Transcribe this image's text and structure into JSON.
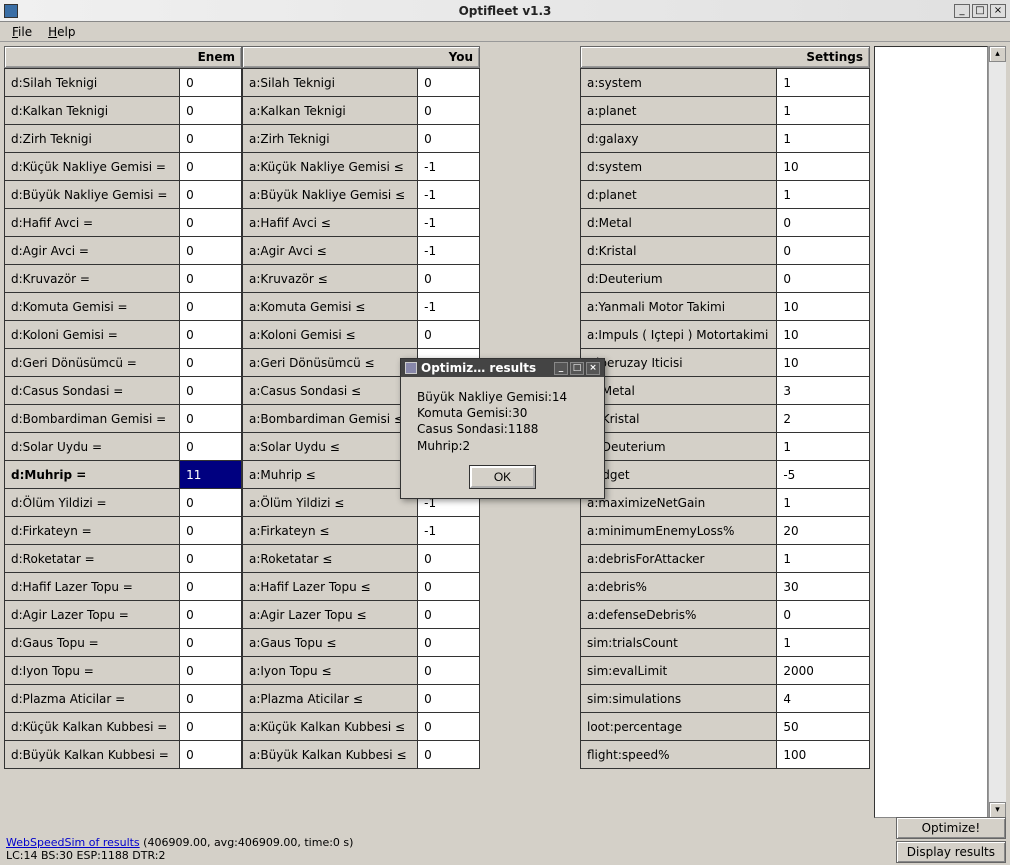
{
  "window": {
    "title": "Optifleet v1.3",
    "min": "_",
    "max": "□",
    "close": "×"
  },
  "menu": {
    "file": "File",
    "help": "Help"
  },
  "headers": {
    "enemy": "Enem",
    "you": "You",
    "settings": "Settings"
  },
  "enemy_rows": [
    {
      "label": "d:Silah Teknigi",
      "val": "0"
    },
    {
      "label": "d:Kalkan Teknigi",
      "val": "0"
    },
    {
      "label": "d:Zirh Teknigi",
      "val": "0"
    },
    {
      "label": "d:Küçük Nakliye Gemisi =",
      "val": "0"
    },
    {
      "label": "d:Büyük Nakliye Gemisi =",
      "val": "0"
    },
    {
      "label": "d:Hafif Avci =",
      "val": "0"
    },
    {
      "label": "d:Agir Avci =",
      "val": "0"
    },
    {
      "label": "d:Kruvazör =",
      "val": "0"
    },
    {
      "label": "d:Komuta Gemisi =",
      "val": "0"
    },
    {
      "label": "d:Koloni Gemisi =",
      "val": "0"
    },
    {
      "label": "d:Geri Dönüsümcü =",
      "val": "0"
    },
    {
      "label": "d:Casus Sondasi =",
      "val": "0"
    },
    {
      "label": "d:Bombardiman Gemisi =",
      "val": "0"
    },
    {
      "label": "d:Solar Uydu =",
      "val": "0"
    },
    {
      "label": "d:Muhrip =",
      "val": "11",
      "bold": true,
      "sel": true
    },
    {
      "label": "d:Ölüm Yildizi =",
      "val": "0"
    },
    {
      "label": "d:Firkateyn =",
      "val": "0"
    },
    {
      "label": "d:Roketatar =",
      "val": "0"
    },
    {
      "label": "d:Hafif Lazer Topu =",
      "val": "0"
    },
    {
      "label": "d:Agir Lazer Topu =",
      "val": "0"
    },
    {
      "label": "d:Gaus Topu =",
      "val": "0"
    },
    {
      "label": "d:Iyon Topu =",
      "val": "0"
    },
    {
      "label": "d:Plazma Aticilar =",
      "val": "0"
    },
    {
      "label": "d:Küçük Kalkan Kubbesi =",
      "val": "0"
    },
    {
      "label": "d:Büyük Kalkan Kubbesi =",
      "val": "0"
    }
  ],
  "you_rows": [
    {
      "label": "a:Silah Teknigi",
      "val": "0"
    },
    {
      "label": "a:Kalkan Teknigi",
      "val": "0"
    },
    {
      "label": "a:Zirh Teknigi",
      "val": "0"
    },
    {
      "label": "a:Küçük Nakliye Gemisi ≤",
      "val": "-1"
    },
    {
      "label": "a:Büyük Nakliye Gemisi ≤",
      "val": "-1"
    },
    {
      "label": "a:Hafif Avci ≤",
      "val": "-1"
    },
    {
      "label": "a:Agir Avci ≤",
      "val": "-1"
    },
    {
      "label": "a:Kruvazör ≤",
      "val": "0"
    },
    {
      "label": "a:Komuta Gemisi ≤",
      "val": "-1"
    },
    {
      "label": "a:Koloni Gemisi ≤",
      "val": "0"
    },
    {
      "label": "a:Geri Dönüsümcü ≤",
      "val": ""
    },
    {
      "label": "a:Casus Sondasi ≤",
      "val": ""
    },
    {
      "label": "a:Bombardiman Gemisi ≤",
      "val": ""
    },
    {
      "label": "a:Solar Uydu ≤",
      "val": ""
    },
    {
      "label": "a:Muhrip ≤",
      "val": ""
    },
    {
      "label": "a:Ölüm Yildizi ≤",
      "val": "-1"
    },
    {
      "label": "a:Firkateyn ≤",
      "val": "-1"
    },
    {
      "label": "a:Roketatar ≤",
      "val": "0"
    },
    {
      "label": "a:Hafif Lazer Topu ≤",
      "val": "0"
    },
    {
      "label": "a:Agir Lazer Topu ≤",
      "val": "0"
    },
    {
      "label": "a:Gaus Topu ≤",
      "val": "0"
    },
    {
      "label": "a:Iyon Topu ≤",
      "val": "0"
    },
    {
      "label": "a:Plazma Aticilar ≤",
      "val": "0"
    },
    {
      "label": "a:Küçük Kalkan Kubbesi ≤",
      "val": "0"
    },
    {
      "label": "a:Büyük Kalkan Kubbesi ≤",
      "val": "0"
    }
  ],
  "settings_rows": [
    {
      "label": "a:system",
      "val": "1"
    },
    {
      "label": "a:planet",
      "val": "1"
    },
    {
      "label": "d:galaxy",
      "val": "1"
    },
    {
      "label": "d:system",
      "val": "10"
    },
    {
      "label": "d:planet",
      "val": "1"
    },
    {
      "label": "d:Metal",
      "val": "0"
    },
    {
      "label": "d:Kristal",
      "val": "0"
    },
    {
      "label": "d:Deuterium",
      "val": "0"
    },
    {
      "label": "a:Yanmali Motor Takimi",
      "val": "10"
    },
    {
      "label": "a:Impuls ( Içtepi ) Motortakimi",
      "val": "10"
    },
    {
      "label": "Hiperuzay Iticisi",
      "val": "10"
    },
    {
      "label": "io:Metal",
      "val": "3"
    },
    {
      "label": "io:Kristal",
      "val": "2"
    },
    {
      "label": "io:Deuterium",
      "val": "1"
    },
    {
      "label": "budget",
      "val": "-5"
    },
    {
      "label": "a:maximizeNetGain",
      "val": "1"
    },
    {
      "label": "a:minimumEnemyLoss%",
      "val": "20"
    },
    {
      "label": "a:debrisForAttacker",
      "val": "1"
    },
    {
      "label": "a:debris%",
      "val": "30"
    },
    {
      "label": "a:defenseDebris%",
      "val": "0"
    },
    {
      "label": "sim:trialsCount",
      "val": "1"
    },
    {
      "label": "sim:evalLimit",
      "val": "2000"
    },
    {
      "label": "sim:simulations",
      "val": "4"
    },
    {
      "label": "loot:percentage",
      "val": "50"
    },
    {
      "label": "flight:speed%",
      "val": "100"
    }
  ],
  "dialog": {
    "title": "Optimiz… results",
    "lines": [
      "Büyük Nakliye Gemisi:14",
      "Komuta Gemisi:30",
      "Casus Sondasi:1188",
      "Muhrip:2"
    ],
    "ok": "OK",
    "min": "_",
    "max": "□",
    "close": "×"
  },
  "footer": {
    "link": "WebSpeedSim of results",
    "summary": " (406909.00, avg:406909.00, time:0 s)",
    "line2": "LC:14 BS:30 ESP:1188 DTR:2"
  },
  "buttons": {
    "optimize": "Optimize!",
    "display": "Display results"
  }
}
